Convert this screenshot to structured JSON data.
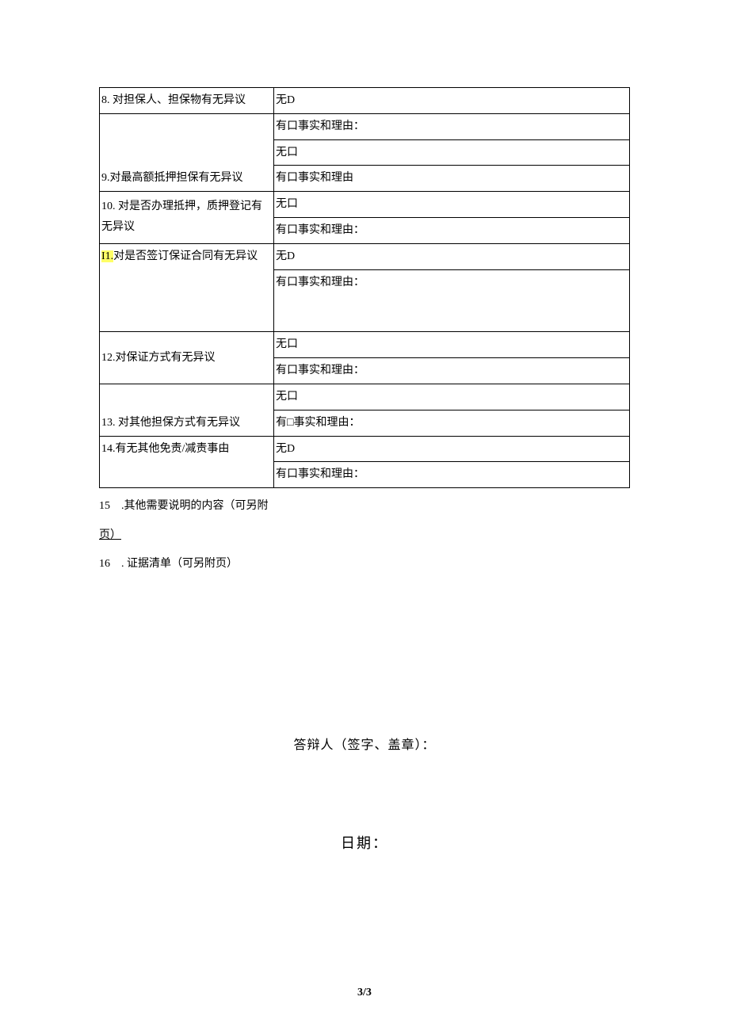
{
  "rows": {
    "r8": {
      "label": "8. 对担保人、担保物有无异议",
      "v1": "无D",
      "v2": "有口事实和理由："
    },
    "r9": {
      "label": "9.对最高额抵押担保有无异议",
      "v1": "无口",
      "v2": "有口事实和理由"
    },
    "r10": {
      "label": "10. 对是否办理抵押，质押登记有无异议",
      "v1": "无口",
      "v2": "有口事实和理由："
    },
    "r11": {
      "hl": "I1.",
      "label_rest": "对是否签订保证合同有无异议",
      "v1": "无D",
      "v2": "有口事实和理由："
    },
    "r12": {
      "label": "12.对保证方式有无异议",
      "v1": "无口",
      "v2": "有口事实和理由："
    },
    "r13": {
      "label": "13. 对其他担保方式有无异议",
      "v1": "无口",
      "v2": "有□事实和理由："
    },
    "r14": {
      "label": "14.有无其他免责/减责事由",
      "v1": "无D",
      "v2": "有口事实和理由："
    }
  },
  "supp": {
    "s15_num": "15",
    "s15_text": ".其他需要说明的内容（可另附",
    "s15_text2": "页）",
    "s16_num": "16",
    "s16_text": ". 证据清单（可另附页）"
  },
  "signature_label": "答辩人（签字、盖章）：",
  "date_label": "日期：",
  "page_num": "3/3"
}
